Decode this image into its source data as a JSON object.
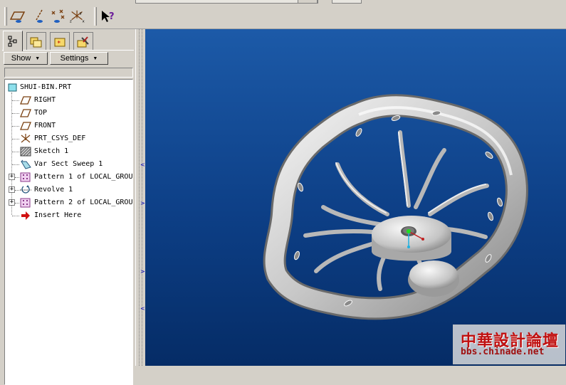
{
  "tabs": [
    {
      "name": "model-tree-tab",
      "icon": "tree-icon",
      "active": true
    },
    {
      "name": "folder-browser-tab",
      "icon": "folder-icon",
      "active": false
    },
    {
      "name": "favorites-tab",
      "icon": "star-folder-icon",
      "active": false
    },
    {
      "name": "connections-tab",
      "icon": "tools-icon",
      "active": false
    }
  ],
  "toolbar": {
    "icons": [
      "datum-plane-display-icon",
      "datum-axis-display-icon",
      "datum-point-display-icon",
      "coordinate-system-display-icon",
      "context-help-icon"
    ]
  },
  "controls": {
    "show_label": "Show",
    "settings_label": "Settings"
  },
  "tree": {
    "root": "SHUI-BIN.PRT",
    "items": [
      {
        "label": "RIGHT",
        "icon": "datum-plane-icon",
        "expandable": false
      },
      {
        "label": "TOP",
        "icon": "datum-plane-icon",
        "expandable": false
      },
      {
        "label": "FRONT",
        "icon": "datum-plane-icon",
        "expandable": false
      },
      {
        "label": "PRT_CSYS_DEF",
        "icon": "csys-icon",
        "expandable": false
      },
      {
        "label": "Sketch 1",
        "icon": "sketch-icon",
        "expandable": false
      },
      {
        "label": "Var Sect Sweep 1",
        "icon": "sweep-icon",
        "expandable": false
      },
      {
        "label": "Pattern 1 of LOCAL_GROU",
        "icon": "pattern-icon",
        "expandable": true
      },
      {
        "label": "Revolve 1",
        "icon": "revolve-icon",
        "expandable": true
      },
      {
        "label": "Pattern 2 of LOCAL_GROU",
        "icon": "pattern-icon",
        "expandable": true
      },
      {
        "label": "Insert Here",
        "icon": "insert-arrow-icon",
        "expandable": false
      }
    ]
  },
  "watermark": {
    "title": "中華設計論壇",
    "url": "bbs.chinade.net"
  },
  "colors": {
    "viewport_top": "#1c5aa8",
    "viewport_bottom": "#052c66",
    "accent_red": "#c01010"
  }
}
